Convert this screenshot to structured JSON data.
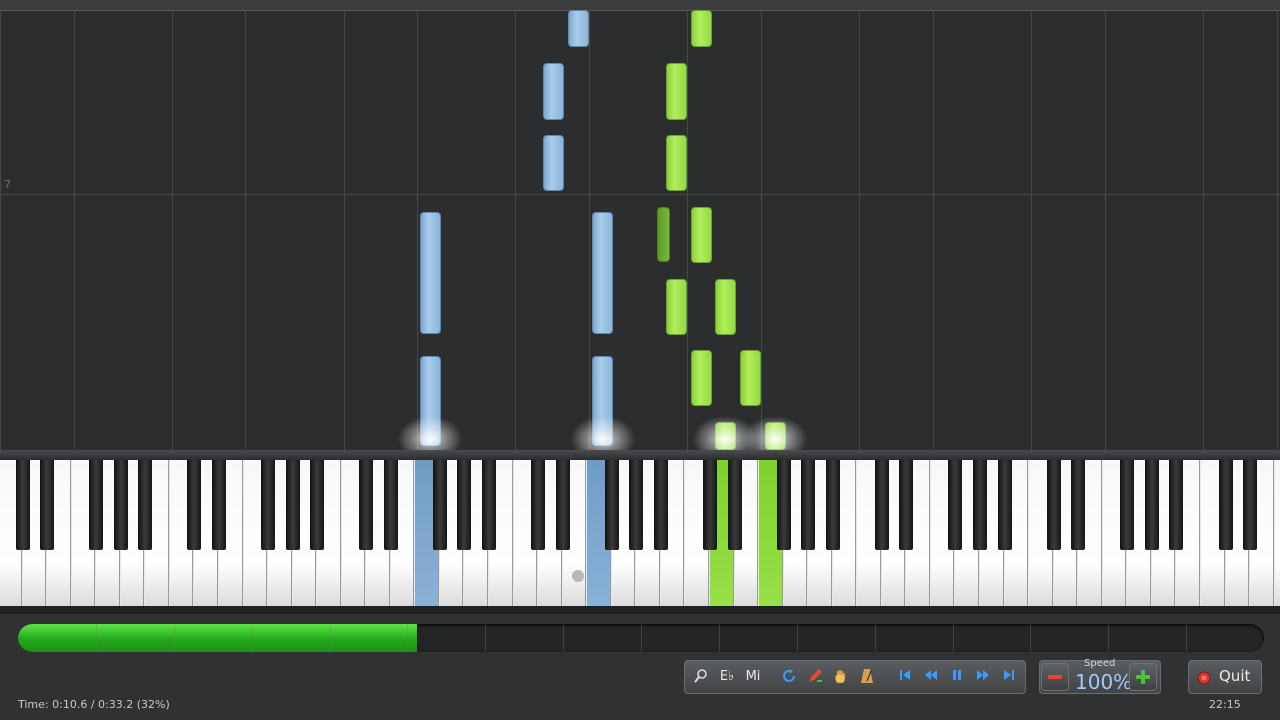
{
  "roll": {
    "measure_number": "7"
  },
  "toolbar": {
    "key_signature_label": "E♭",
    "note_label": "Mi",
    "speed_title": "Speed",
    "speed_value": "100%",
    "quit_label": "Quit"
  },
  "status": {
    "time_text": "Time:  0:10.6 / 0:33.2 (32%)",
    "clock": "22:15"
  },
  "playback": {
    "progress_fraction": 0.32
  },
  "colors": {
    "left_hand": "#8cb4d8",
    "right_hand": "#a4e650",
    "progress": "#2fbf22"
  },
  "icons": [
    "zoom-icon",
    "loop-icon",
    "pencil-icon",
    "hand-icon",
    "metronome-icon",
    "skip-start-icon",
    "rewind-icon",
    "pause-icon",
    "fast-forward-icon",
    "skip-end-icon",
    "minus-icon",
    "plus-icon",
    "stop-icon"
  ]
}
